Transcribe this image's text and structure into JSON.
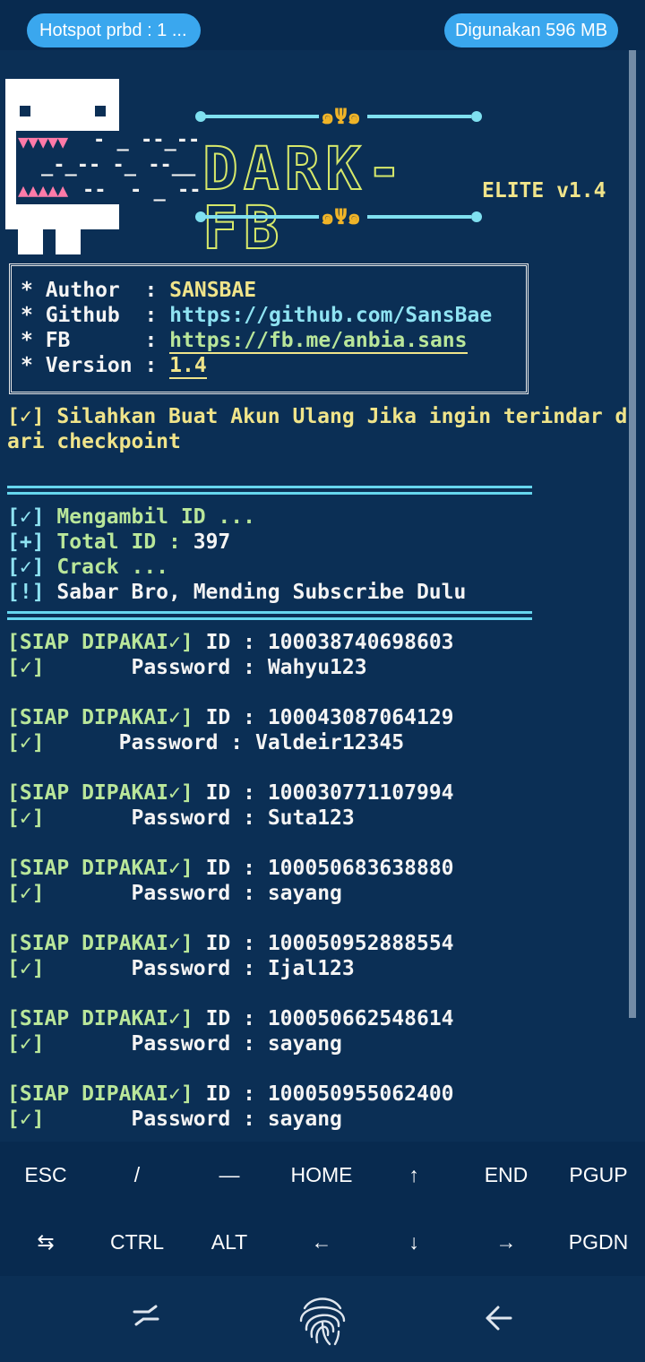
{
  "status": {
    "hotspot": "Hotspot prbd : 1 ...",
    "usage": "Digunakan 596 MB"
  },
  "logo": {
    "ascii1": "- _ --_--",
    "ascii2": "_-_-- -_ --__",
    "ascii3": "--  - _ --",
    "title": "DARK-FB",
    "edition": "ELITE v1.4"
  },
  "info": {
    "author_key": "* Author  : ",
    "author_val": "SANSBAE",
    "github_key": "* Github  : ",
    "github_val": "https://github.com/SansBae",
    "fb_key": "* FB      : ",
    "fb_val": "https://fb.me/anbia.sans",
    "version_key": "* Version : ",
    "version_val": "1.4"
  },
  "notice": {
    "line1": "[✓] Silahkan Buat Akun Ulang Jika ingin terindar d",
    "line2": "ari checkpoint"
  },
  "progress": {
    "p1_tag": "[✓] ",
    "p1_text": "Mengambil ID ...",
    "p2_tag": "[+] ",
    "p2_text": "Total ID : ",
    "p2_val": "397",
    "p3_tag": "[✓] ",
    "p3_text": "Crack ...",
    "p4_tag": "[!] ",
    "p4_text": "Sabar Bro, Mending Subscribe Dulu"
  },
  "results": [
    {
      "tag": "[SIAP DIPAKAI✓]",
      "id_label": " ID : ",
      "id": "100038740698603",
      "pw_tag": "[✓]",
      "pw_label": "Password : ",
      "pw": "Wahyu123",
      "indent": "       "
    },
    {
      "tag": "[SIAP DIPAKAI✓]",
      "id_label": " ID : ",
      "id": "100043087064129",
      "pw_tag": "[✓]",
      "pw_label": "Password : ",
      "pw": "Valdeir12345",
      "indent": "      "
    },
    {
      "tag": "[SIAP DIPAKAI✓]",
      "id_label": " ID : ",
      "id": "100030771107994",
      "pw_tag": "[✓]",
      "pw_label": "Password : ",
      "pw": "Suta123",
      "indent": "       "
    },
    {
      "tag": "[SIAP DIPAKAI✓]",
      "id_label": " ID : ",
      "id": "100050683638880",
      "pw_tag": "[✓]",
      "pw_label": "Password : ",
      "pw": "sayang",
      "indent": "       "
    },
    {
      "tag": "[SIAP DIPAKAI✓]",
      "id_label": " ID : ",
      "id": "100050952888554",
      "pw_tag": "[✓]",
      "pw_label": "Password : ",
      "pw": "Ijal123",
      "indent": "       "
    },
    {
      "tag": "[SIAP DIPAKAI✓]",
      "id_label": " ID : ",
      "id": "100050662548614",
      "pw_tag": "[✓]",
      "pw_label": "Password : ",
      "pw": "sayang",
      "indent": "       "
    },
    {
      "tag": "[SIAP DIPAKAI✓]",
      "id_label": " ID : ",
      "id": "100050955062400",
      "pw_tag": "[✓]",
      "pw_label": "Password : ",
      "pw": "sayang",
      "indent": "       "
    }
  ],
  "keys_row1": [
    "ESC",
    "/",
    "—",
    "HOME",
    "↑",
    "END",
    "PGUP"
  ],
  "keys_row2": [
    "⇆",
    "CTRL",
    "ALT",
    "←",
    "↓",
    "→",
    "PGDN"
  ],
  "nav": {
    "recent": "recent-apps-icon",
    "home": "fingerprint-icon",
    "back": "back-icon"
  },
  "colors": {
    "background": "#0b2f55",
    "accent_cyan": "#8fe3f2",
    "accent_yellow": "#f0e48a",
    "accent_green": "#b9e69a",
    "pill": "#3aa7ee"
  }
}
